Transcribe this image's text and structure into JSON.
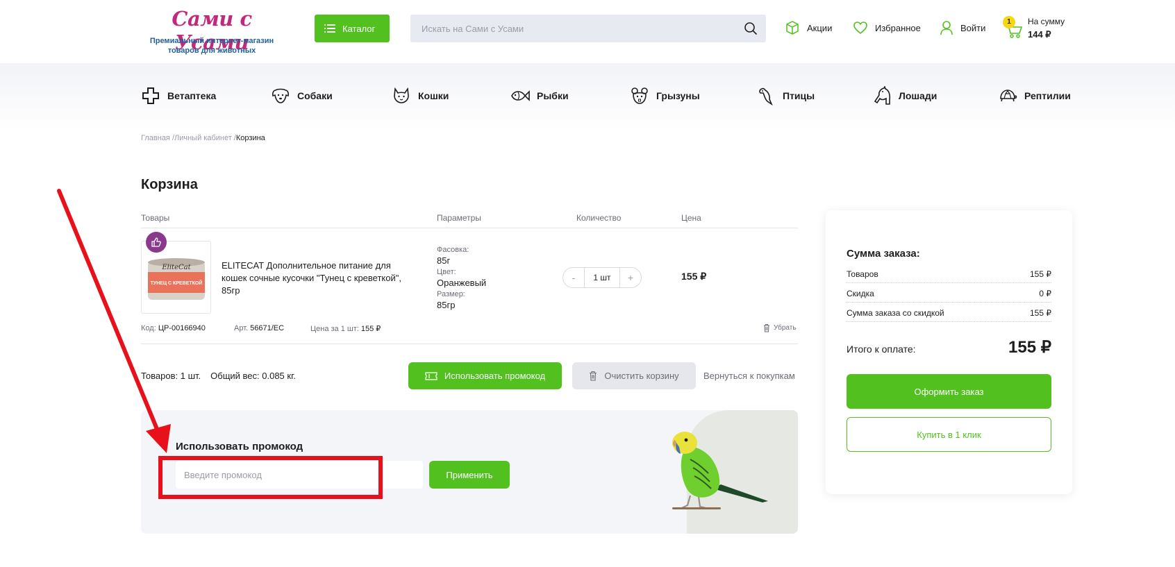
{
  "header": {
    "logo_title": "Сами с Усами",
    "logo_subtitle_line1": "Премиальный интернет-магазин",
    "logo_subtitle_line2": "товаров для животных",
    "catalog_label": "Каталог",
    "search_placeholder": "Искать на Сами с Усами",
    "promo_link": "Акции",
    "favorites_link": "Избранное",
    "login_link": "Войти",
    "cart": {
      "count": "1",
      "label": "На сумму",
      "sum": "144 ₽"
    }
  },
  "categories": [
    {
      "label": "Ветаптека",
      "icon": "cross-icon"
    },
    {
      "label": "Собаки",
      "icon": "dog-icon"
    },
    {
      "label": "Кошки",
      "icon": "cat-icon"
    },
    {
      "label": "Рыбки",
      "icon": "fish-icon"
    },
    {
      "label": "Грызуны",
      "icon": "rodent-icon"
    },
    {
      "label": "Птицы",
      "icon": "bird-icon"
    },
    {
      "label": "Лошади",
      "icon": "horse-icon"
    },
    {
      "label": "Рептилии",
      "icon": "turtle-icon"
    }
  ],
  "breadcrumb": {
    "home": "Главная",
    "account": "Личный кабинет",
    "current": "Корзина"
  },
  "page_title": "Корзина",
  "table_headers": {
    "goods": "Товары",
    "params": "Параметры",
    "qty": "Количество",
    "price": "Цена"
  },
  "item": {
    "name": "ELITECAT Дополнительное питание для кошек сочные кусочки \"Тунец с креветкой\", 85гр",
    "image_brand": "EliteCat",
    "image_text": "ТУНЕЦ С КРЕВЕТКОЙ",
    "params": [
      {
        "label": "Фасовка:",
        "value": "85г"
      },
      {
        "label": "Цвет:",
        "value": "Оранжевый"
      },
      {
        "label": "Размер:",
        "value": "85гр"
      }
    ],
    "qty_minus": "-",
    "qty_value": "1 шт",
    "qty_plus": "+",
    "price": "155 ₽",
    "code_label": "Код:",
    "code": "ЦР-00166940",
    "art_label": "Арт.",
    "art": "56671/EC",
    "unit_price_label": "Цена за 1 шт:",
    "unit_price": "155 ₽",
    "remove_label": "Убрать"
  },
  "cart_summary": {
    "items": "Товаров: 1 шт.",
    "weight": "Общий вес: 0.085 кг."
  },
  "actions": {
    "use_promo": "Использовать промокод",
    "clear_cart": "Очистить корзину",
    "back_to_shopping": "Вернуться к покупкам"
  },
  "promo": {
    "title": "Использовать промокод",
    "placeholder": "Введите промокод",
    "apply": "Применить"
  },
  "order": {
    "title": "Сумма заказа:",
    "rows": [
      {
        "label": "Товаров",
        "value": "155 ₽"
      },
      {
        "label": "Скидка",
        "value": "0 ₽"
      },
      {
        "label": "Сумма заказа со скидкой",
        "value": "155 ₽"
      }
    ],
    "total_label": "Итого к оплате:",
    "total_value": "155 ₽",
    "checkout": "Оформить заказ",
    "one_click": "Купить в 1 клик"
  },
  "colors": {
    "accent": "#52c01f",
    "brand": "#c12a7a",
    "annotation": "#e8101a"
  }
}
